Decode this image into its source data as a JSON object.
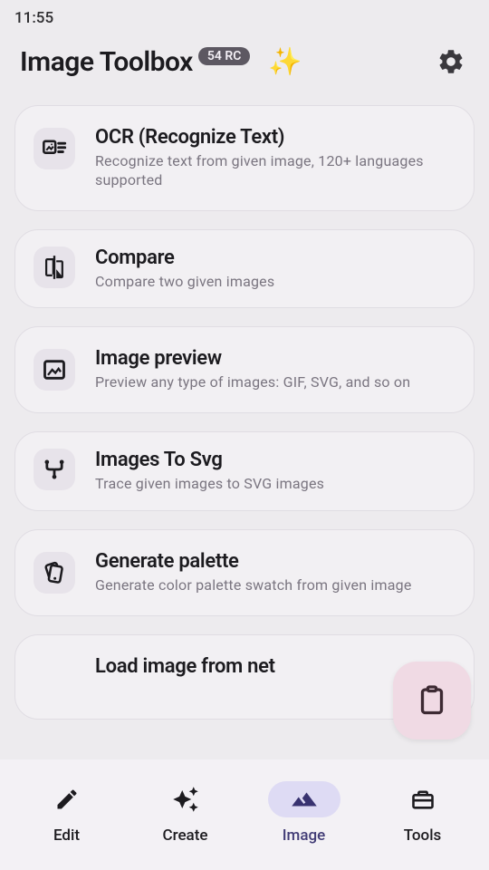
{
  "status": {
    "time": "11:55"
  },
  "header": {
    "title": "Image Toolbox",
    "badge": "54 RC",
    "sparkle": "✨"
  },
  "cards": [
    {
      "title": "OCR (Recognize Text)",
      "desc": "Recognize text from given image, 120+ languages supported"
    },
    {
      "title": "Compare",
      "desc": "Compare two given images"
    },
    {
      "title": "Image preview",
      "desc": "Preview any type of images: GIF, SVG, and so on"
    },
    {
      "title": "Images To Svg",
      "desc": "Trace given images to SVG images"
    },
    {
      "title": "Generate palette",
      "desc": "Generate color palette swatch from given image"
    },
    {
      "title": "Load image from net",
      "desc": ""
    }
  ],
  "nav": {
    "items": [
      {
        "label": "Edit"
      },
      {
        "label": "Create"
      },
      {
        "label": "Image"
      },
      {
        "label": "Tools"
      }
    ]
  }
}
